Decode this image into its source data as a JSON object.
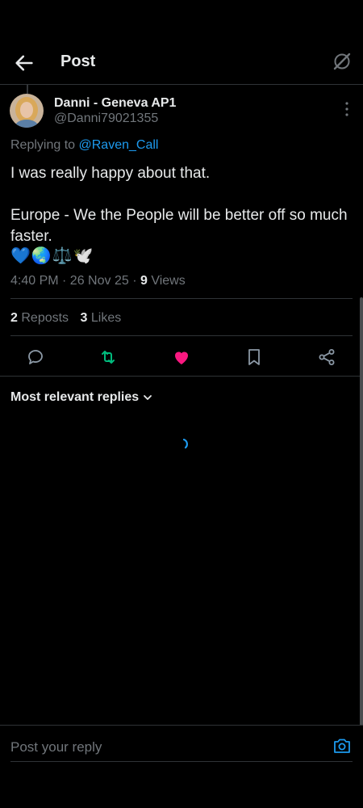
{
  "header": {
    "title": "Post",
    "back_icon": "arrow-left-icon",
    "grok_icon": "grok-icon"
  },
  "post": {
    "author_name": "Danni - Geneva AP1",
    "author_handle": "@Danni79021355",
    "replying_prefix": "Replying to",
    "replying_to": "@Raven_Call",
    "text_line1": "I was really happy about that.",
    "text_line2": "Europe - We the People will be better off so much faster.",
    "emojis": "💙🌏⚖️🕊️",
    "timestamp": "4:40 PM · 26 Nov 25 · ",
    "views_count": "9",
    "views_label": "Views"
  },
  "stats": {
    "reposts_count": "2",
    "reposts_label": "Reposts",
    "likes_count": "3",
    "likes_label": "Likes"
  },
  "actions": {
    "reply_icon": "comment-icon",
    "repost_icon": "repost-icon",
    "like_icon": "heart-icon",
    "bookmark_icon": "bookmark-icon",
    "share_icon": "share-icon",
    "repost_color": "#00ba7c",
    "like_color": "#f91880"
  },
  "replies": {
    "sort_label": "Most relevant replies"
  },
  "composer": {
    "placeholder": "Post your reply",
    "camera_icon": "camera-icon"
  },
  "colors": {
    "accent": "#1d9bf0",
    "background": "#000000",
    "muted": "#71767b"
  }
}
